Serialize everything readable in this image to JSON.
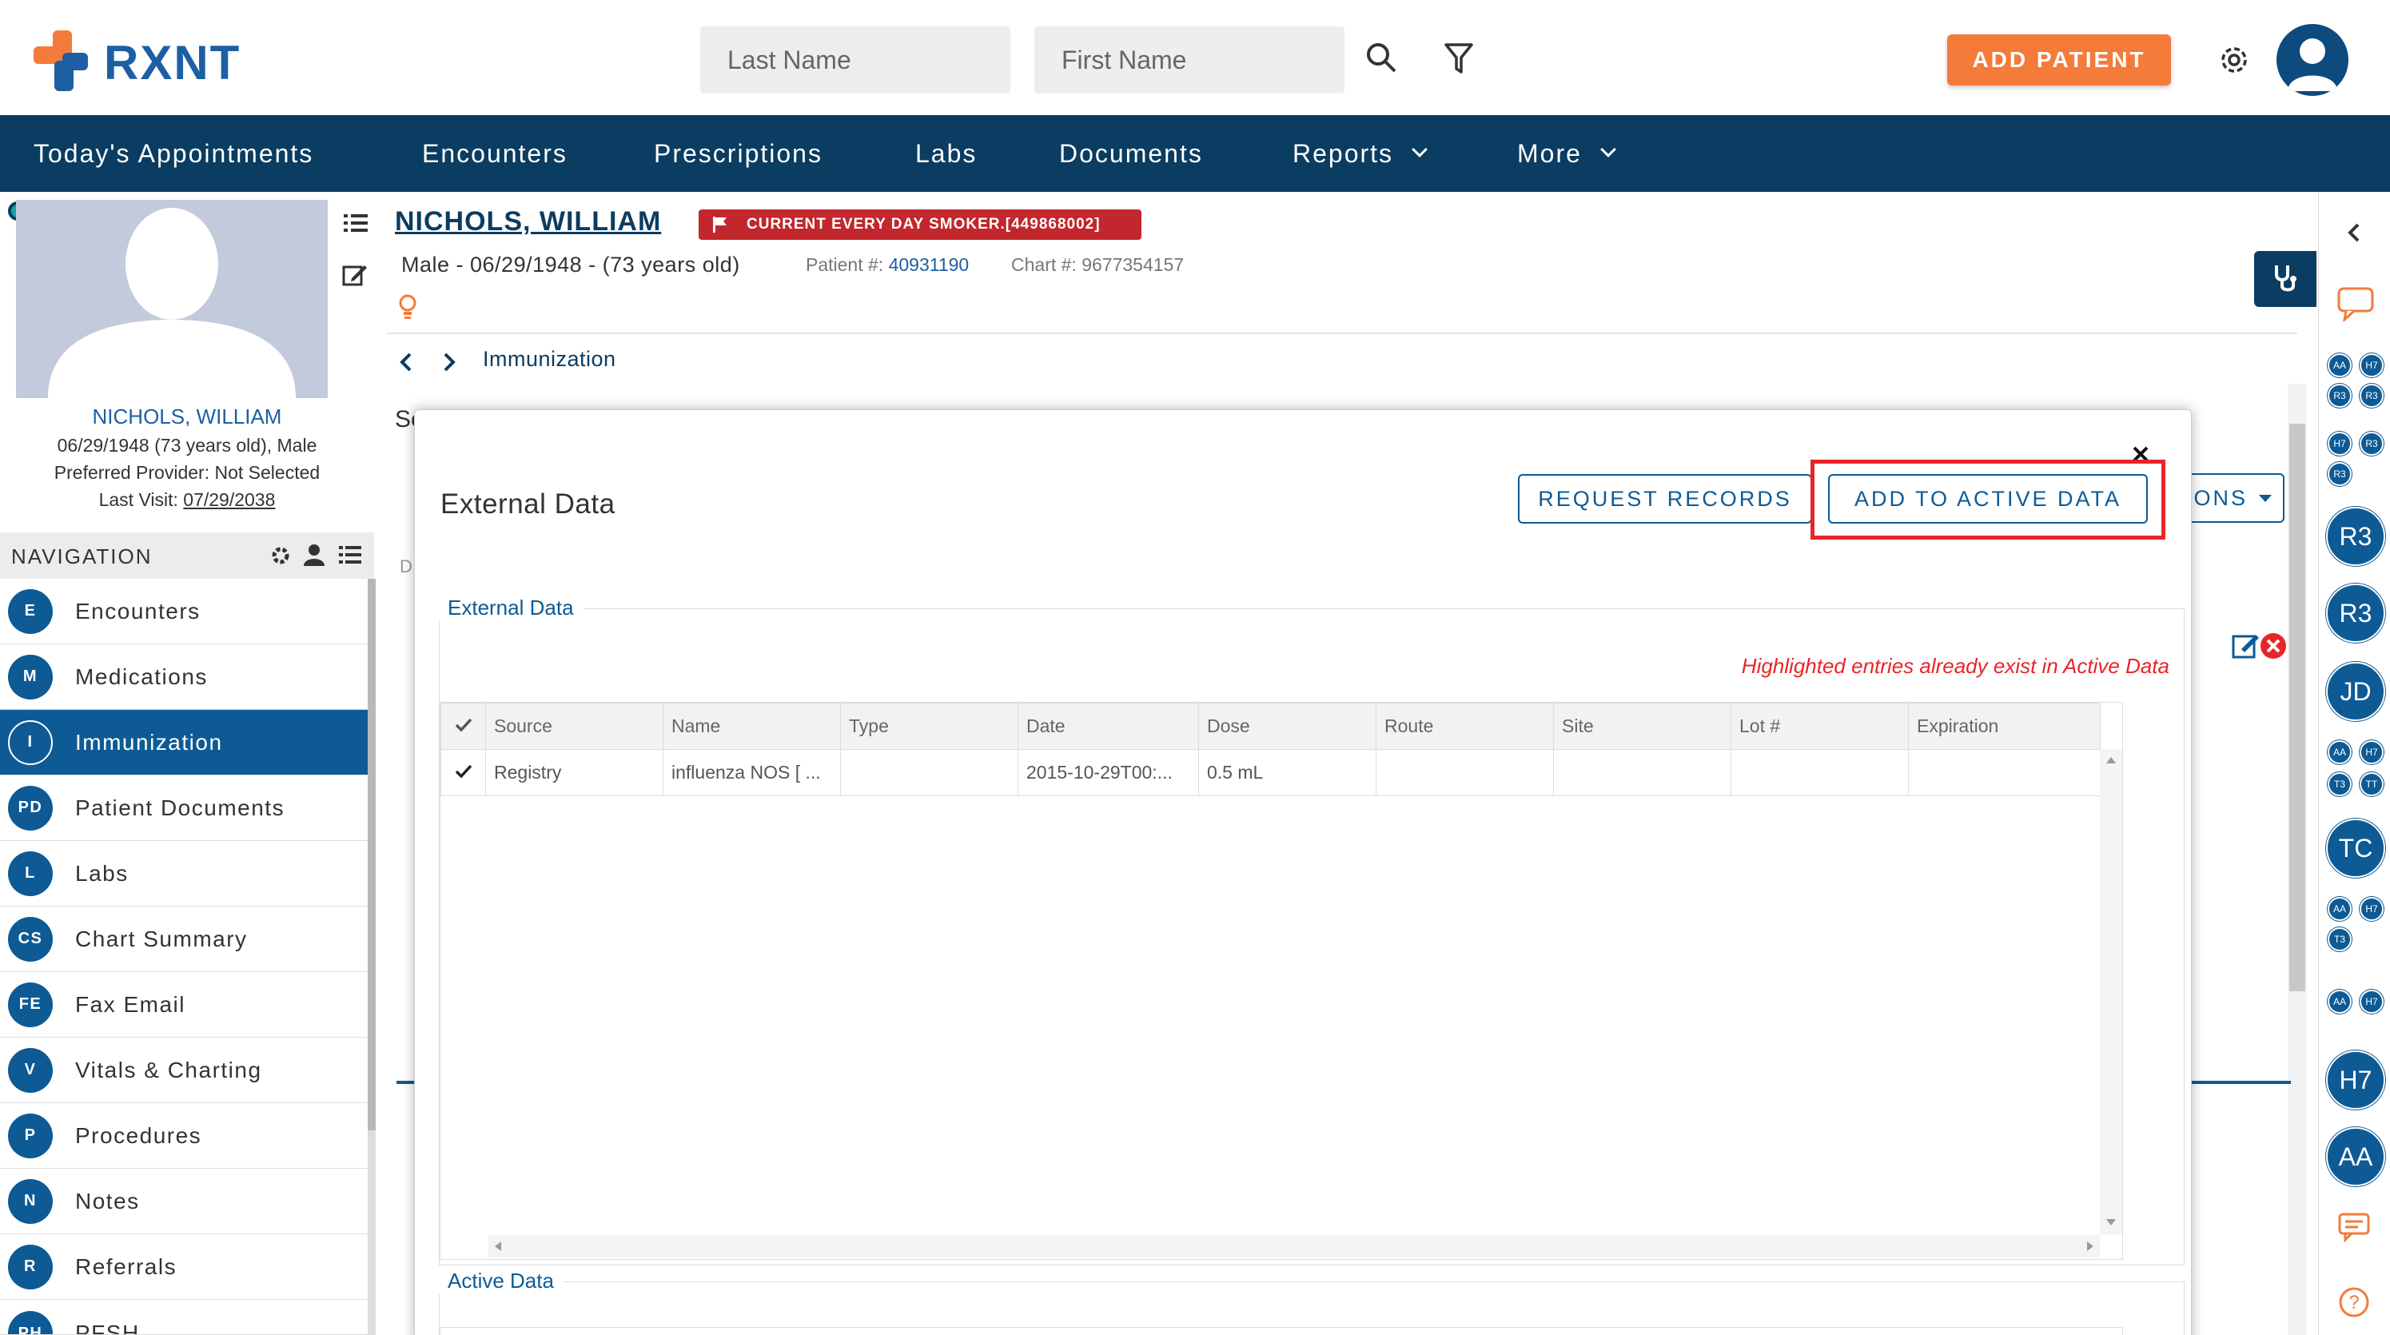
{
  "app": {
    "logo_text": "RXNT"
  },
  "header": {
    "last_name_placeholder": "Last Name",
    "first_name_placeholder": "First Name",
    "add_patient_label": "ADD PATIENT"
  },
  "menu": [
    {
      "label": "Today's Appointments"
    },
    {
      "label": "Encounters"
    },
    {
      "label": "Prescriptions"
    },
    {
      "label": "Labs"
    },
    {
      "label": "Documents"
    },
    {
      "label": "Reports"
    },
    {
      "label": "More"
    }
  ],
  "patient_card": {
    "name": "NICHOLS, WILLIAM",
    "dob_line": "06/29/1948 (73 years old), Male",
    "provider_line": "Preferred Provider: Not Selected",
    "last_visit_label": "Last Visit:",
    "last_visit_date": "07/29/2038"
  },
  "navigation": {
    "title": "NAVIGATION",
    "items": [
      {
        "abbr": "E",
        "label": "Encounters"
      },
      {
        "abbr": "M",
        "label": "Medications"
      },
      {
        "abbr": "I",
        "label": "Immunization"
      },
      {
        "abbr": "PD",
        "label": "Patient Documents"
      },
      {
        "abbr": "L",
        "label": "Labs"
      },
      {
        "abbr": "CS",
        "label": "Chart Summary"
      },
      {
        "abbr": "FE",
        "label": "Fax Email"
      },
      {
        "abbr": "V",
        "label": "Vitals & Charting"
      },
      {
        "abbr": "P",
        "label": "Procedures"
      },
      {
        "abbr": "N",
        "label": "Notes"
      },
      {
        "abbr": "R",
        "label": "Referrals"
      },
      {
        "abbr": "PH",
        "label": "PFSH"
      }
    ]
  },
  "patient_header": {
    "name": "NICHOLS, WILLIAM",
    "alert": "CURRENT EVERY DAY SMOKER.[449868002]",
    "demographics": "Male - 06/29/1948 - (73 years old)",
    "patient_num_label": "Patient #:",
    "patient_num": "40931190",
    "chart_num_label": "Chart #:",
    "chart_num": "9677354157",
    "breadcrumb": "Immunization",
    "partial_label_se": "Se",
    "partial_label_d": "D",
    "partial_button": "ONS"
  },
  "modal": {
    "title": "External Data",
    "request_records_label": "REQUEST RECORDS",
    "add_active_label": "ADD TO ACTIVE DATA",
    "external_legend": "External Data",
    "highlight_note": "Highlighted entries already exist in Active Data",
    "columns": [
      "Source",
      "Name",
      "Type",
      "Date",
      "Dose",
      "Route",
      "Site",
      "Lot #",
      "Expiration"
    ],
    "rows": [
      {
        "Source": "Registry",
        "Name": "influenza NOS [ ...",
        "Type": "",
        "Date": "2015-10-29T00:...",
        "Dose": "0.5 mL",
        "Route": "",
        "Site": "",
        "Lot #": "",
        "Expiration": ""
      }
    ],
    "active_legend": "Active Data"
  },
  "right_sidebar": {
    "bubbles": [
      "AA",
      "H7",
      "R3",
      "R3",
      "H7",
      "R3",
      "R3",
      "R3",
      "R3",
      "JD",
      "AA",
      "H7",
      "T3",
      "TT",
      "TC",
      "AA",
      "H7",
      "T3",
      "AA",
      "H7",
      "H7",
      "AA"
    ]
  },
  "colors": {
    "brand_navy": "#0b3c61",
    "primary_blue": "#0d5a95",
    "accent_orange": "#f47b3a",
    "alert_red": "#c1272d",
    "highlight_red": "#e8252a"
  }
}
